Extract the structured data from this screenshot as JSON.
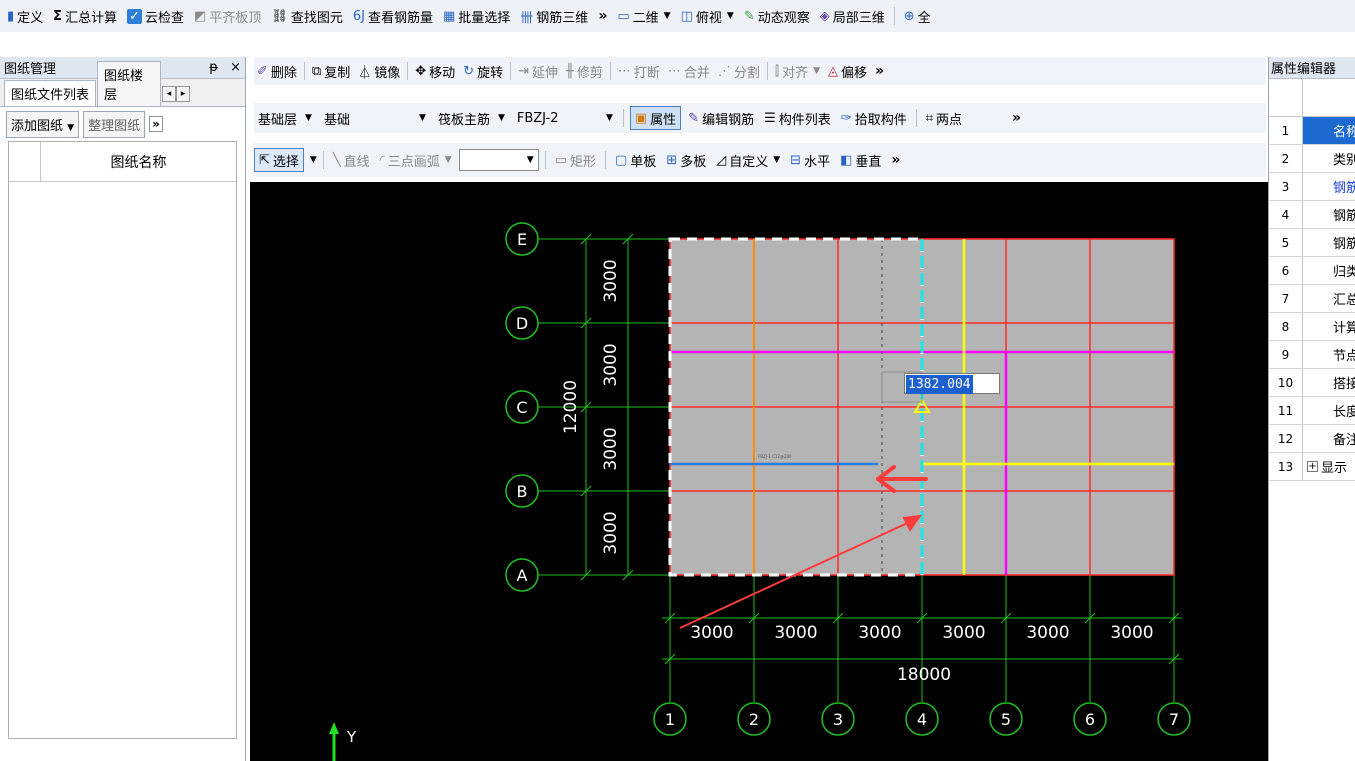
{
  "toolbar1": {
    "items": [
      {
        "icon": "define-icon",
        "label": "定义"
      },
      {
        "icon": "sigma-icon",
        "label": "汇总计算"
      },
      {
        "icon": "cloud-check-icon",
        "label": "云检查"
      },
      {
        "icon": "slab-top-icon",
        "label": "平齐板顶"
      },
      {
        "icon": "binoculars-icon",
        "label": "查找图元"
      },
      {
        "icon": "rebar-view-icon",
        "label": "查看钢筋量"
      },
      {
        "icon": "batch-select-icon",
        "label": "批量选择"
      },
      {
        "icon": "rebar-3d-icon",
        "label": "钢筋三维"
      }
    ],
    "overflow": "»",
    "view_items": [
      {
        "icon": "2d-icon",
        "label": "二维"
      },
      {
        "icon": "top-view-icon",
        "label": "俯视"
      },
      {
        "icon": "dynamic-view-icon",
        "label": "动态观察"
      },
      {
        "icon": "local-3d-icon",
        "label": "局部三维"
      },
      {
        "icon": "zoom-all-icon",
        "label": "全"
      }
    ]
  },
  "left_panel": {
    "title": "图纸管理",
    "pin": "ᵽ",
    "close": "×",
    "tabs": [
      "图纸文件列表",
      "图纸楼层"
    ],
    "add_button": "添加图纸",
    "organize_button": "整理图纸",
    "overflow": "»",
    "table_header": "图纸名称"
  },
  "toolbar2": {
    "items": [
      {
        "icon": "delete-icon",
        "label": "删除"
      },
      {
        "icon": "copy-icon",
        "label": "复制"
      },
      {
        "icon": "mirror-icon",
        "label": "镜像"
      },
      {
        "icon": "move-icon",
        "label": "移动"
      },
      {
        "icon": "rotate-icon",
        "label": "旋转"
      },
      {
        "icon": "extend-icon",
        "label": "延伸"
      },
      {
        "icon": "trim-icon",
        "label": "修剪"
      },
      {
        "icon": "break-icon",
        "label": "打断"
      },
      {
        "icon": "merge-icon",
        "label": "合并"
      },
      {
        "icon": "split-icon",
        "label": "分割"
      },
      {
        "icon": "align-icon",
        "label": "对齐"
      },
      {
        "icon": "offset-icon",
        "label": "偏移"
      }
    ],
    "overflow": "»"
  },
  "toolbar3": {
    "floor": "基础层",
    "category": "基础",
    "component_type": "筏板主筋",
    "component_name": "FBZJ-2",
    "attr_button": "属性",
    "edit_rebar": "编辑钢筋",
    "component_list": "构件列表",
    "pick_component": "拾取构件",
    "two_points": "两点",
    "overflow": "»"
  },
  "toolbar4": {
    "select": "选择",
    "line": "直线",
    "arc": "三点画弧",
    "rect": "矩形",
    "single_slab": "单板",
    "multi_slab": "多板",
    "custom": "自定义",
    "horizontal": "水平",
    "vertical": "垂直",
    "overflow": "»"
  },
  "canvas": {
    "length_input": "1382.004",
    "axis_rows": [
      "E",
      "D",
      "C",
      "B",
      "A"
    ],
    "axis_cols": [
      "1",
      "2",
      "3",
      "4",
      "5",
      "6",
      "7"
    ],
    "row_dims": [
      "3000",
      "3000",
      "3000",
      "3000"
    ],
    "row_total": "12000",
    "col_dims": [
      "3000",
      "3000",
      "3000",
      "3000",
      "3000",
      "3000"
    ],
    "col_total": "18000",
    "small_label": "FBZJ-1 C12@200",
    "ucs_y": "Y"
  },
  "right_panel": {
    "title": "属性编辑器",
    "rows": [
      {
        "n": "1",
        "v": "名称"
      },
      {
        "n": "2",
        "v": "类别"
      },
      {
        "n": "3",
        "v": "钢筋"
      },
      {
        "n": "4",
        "v": "钢筋"
      },
      {
        "n": "5",
        "v": "钢筋"
      },
      {
        "n": "6",
        "v": "归类"
      },
      {
        "n": "7",
        "v": "汇总"
      },
      {
        "n": "8",
        "v": "计算"
      },
      {
        "n": "9",
        "v": "节点"
      },
      {
        "n": "10",
        "v": "搭接"
      },
      {
        "n": "11",
        "v": "长度"
      },
      {
        "n": "12",
        "v": "备注"
      },
      {
        "n": "13",
        "v": "显示"
      }
    ]
  },
  "colors": {
    "grid_red": "#ff2a2a",
    "axis_green": "#20c020",
    "slab_gray": "#b4b4b4",
    "magenta": "#ff00ff",
    "yellow": "#ffff00",
    "cyan": "#19e6e6",
    "blue_line": "#2a7de0",
    "arrow_red": "#ff3b3b"
  }
}
